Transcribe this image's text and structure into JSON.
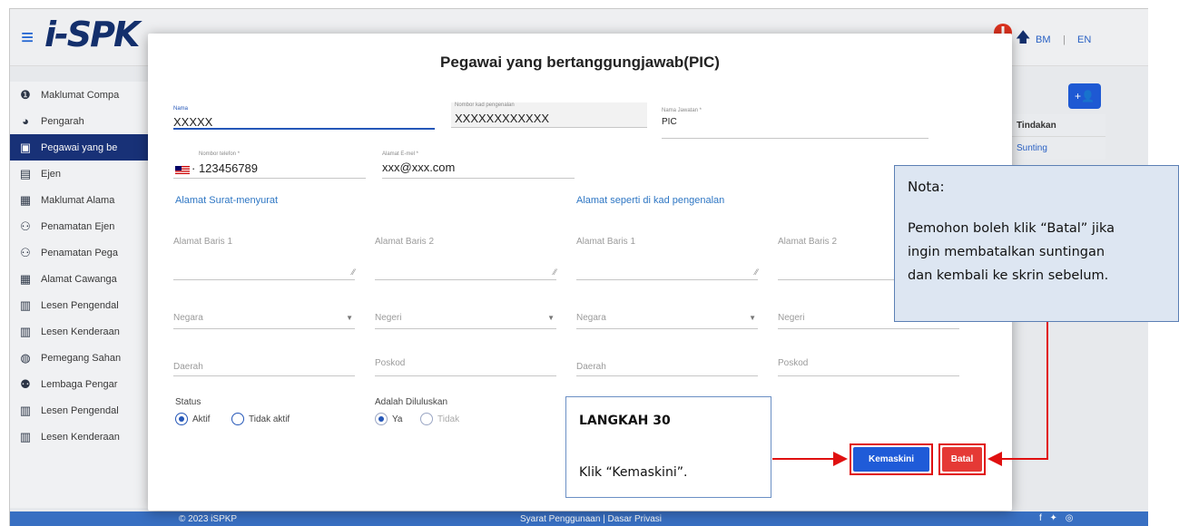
{
  "header": {
    "logo_text": "i-SPK",
    "lang_bm": "BM",
    "lang_sep": "|",
    "lang_en": "EN"
  },
  "sidebar": {
    "items": [
      {
        "label": "Maklumat Compa",
        "icon": "info-icon"
      },
      {
        "label": "Pengarah",
        "icon": "person-badge-icon"
      },
      {
        "label": "Pegawai yang be",
        "icon": "id-card-icon",
        "active": true
      },
      {
        "label": "Ejen",
        "icon": "id-badge-icon"
      },
      {
        "label": "Maklumat Alama",
        "icon": "document-icon"
      },
      {
        "label": "Penamatan Ejen",
        "icon": "people-icon"
      },
      {
        "label": "Penamatan Pega",
        "icon": "people-icon"
      },
      {
        "label": "Alamat Cawanga",
        "icon": "document-icon"
      },
      {
        "label": "Lesen Pengendal",
        "icon": "license-icon"
      },
      {
        "label": "Lesen Kenderaan",
        "icon": "license-icon"
      },
      {
        "label": "Pemegang Sahan",
        "icon": "user-circle-icon"
      },
      {
        "label": "Lembaga Pengar",
        "icon": "users-cog-icon"
      },
      {
        "label": "Lesen Pengendal",
        "icon": "license-icon"
      },
      {
        "label": "Lesen Kenderaan",
        "icon": "license-icon"
      }
    ]
  },
  "table": {
    "action_header": "Tindakan",
    "edit_link": "Sunting"
  },
  "footer": {
    "copyright": "© 2023 iSPKP",
    "links": "Syarat Penggunaan | Dasar Privasi",
    "social": "f ✦ ◎"
  },
  "modal": {
    "title": "Pegawai yang bertanggungjawab(PIC)",
    "fields": {
      "nama_label": "Nama",
      "nama_value": "XXXXX",
      "ic_label": "Nombor kad pengenalan",
      "ic_value": "XXXXXXXXXXXX",
      "jawatan_label": "Nama Jawatan *",
      "jawatan_value": "PIC",
      "phone_label": "Nombor telefon *",
      "phone_value": "· 123456789",
      "email_label": "Alamat E-mel *",
      "email_value": "xxx@xxx.com"
    },
    "section_mailing": "Alamat Surat-menyurat",
    "section_ic": "Alamat seperti di kad pengenalan",
    "address_line1": "Alamat Baris 1",
    "address_line2": "Alamat Baris 2",
    "country": "Negara",
    "state": "Negeri",
    "district": "Daerah",
    "postcode": "Poskod",
    "status_label": "Status",
    "status_active": "Aktif",
    "status_inactive": "Tidak aktif",
    "approved_label": "Adalah Diluluskan",
    "approved_yes": "Ya",
    "approved_no": "Tidak",
    "update_button": "Kemaskini",
    "cancel_button": "Batal"
  },
  "callouts": {
    "note_title": "Nota:",
    "note_line1": "Pemohon boleh klik “Batal” jika",
    "note_line2": "ingin membatalkan suntingan",
    "note_line3": "dan kembali ke skrin sebelum.",
    "step_title": "LANGKAH 30",
    "step_desc": "Klik “Kemaskini”."
  },
  "colors": {
    "primary": "#1f5bd8",
    "danger": "#e53935",
    "sidebar_active": "#19327a",
    "annotation_red": "#e01010"
  }
}
